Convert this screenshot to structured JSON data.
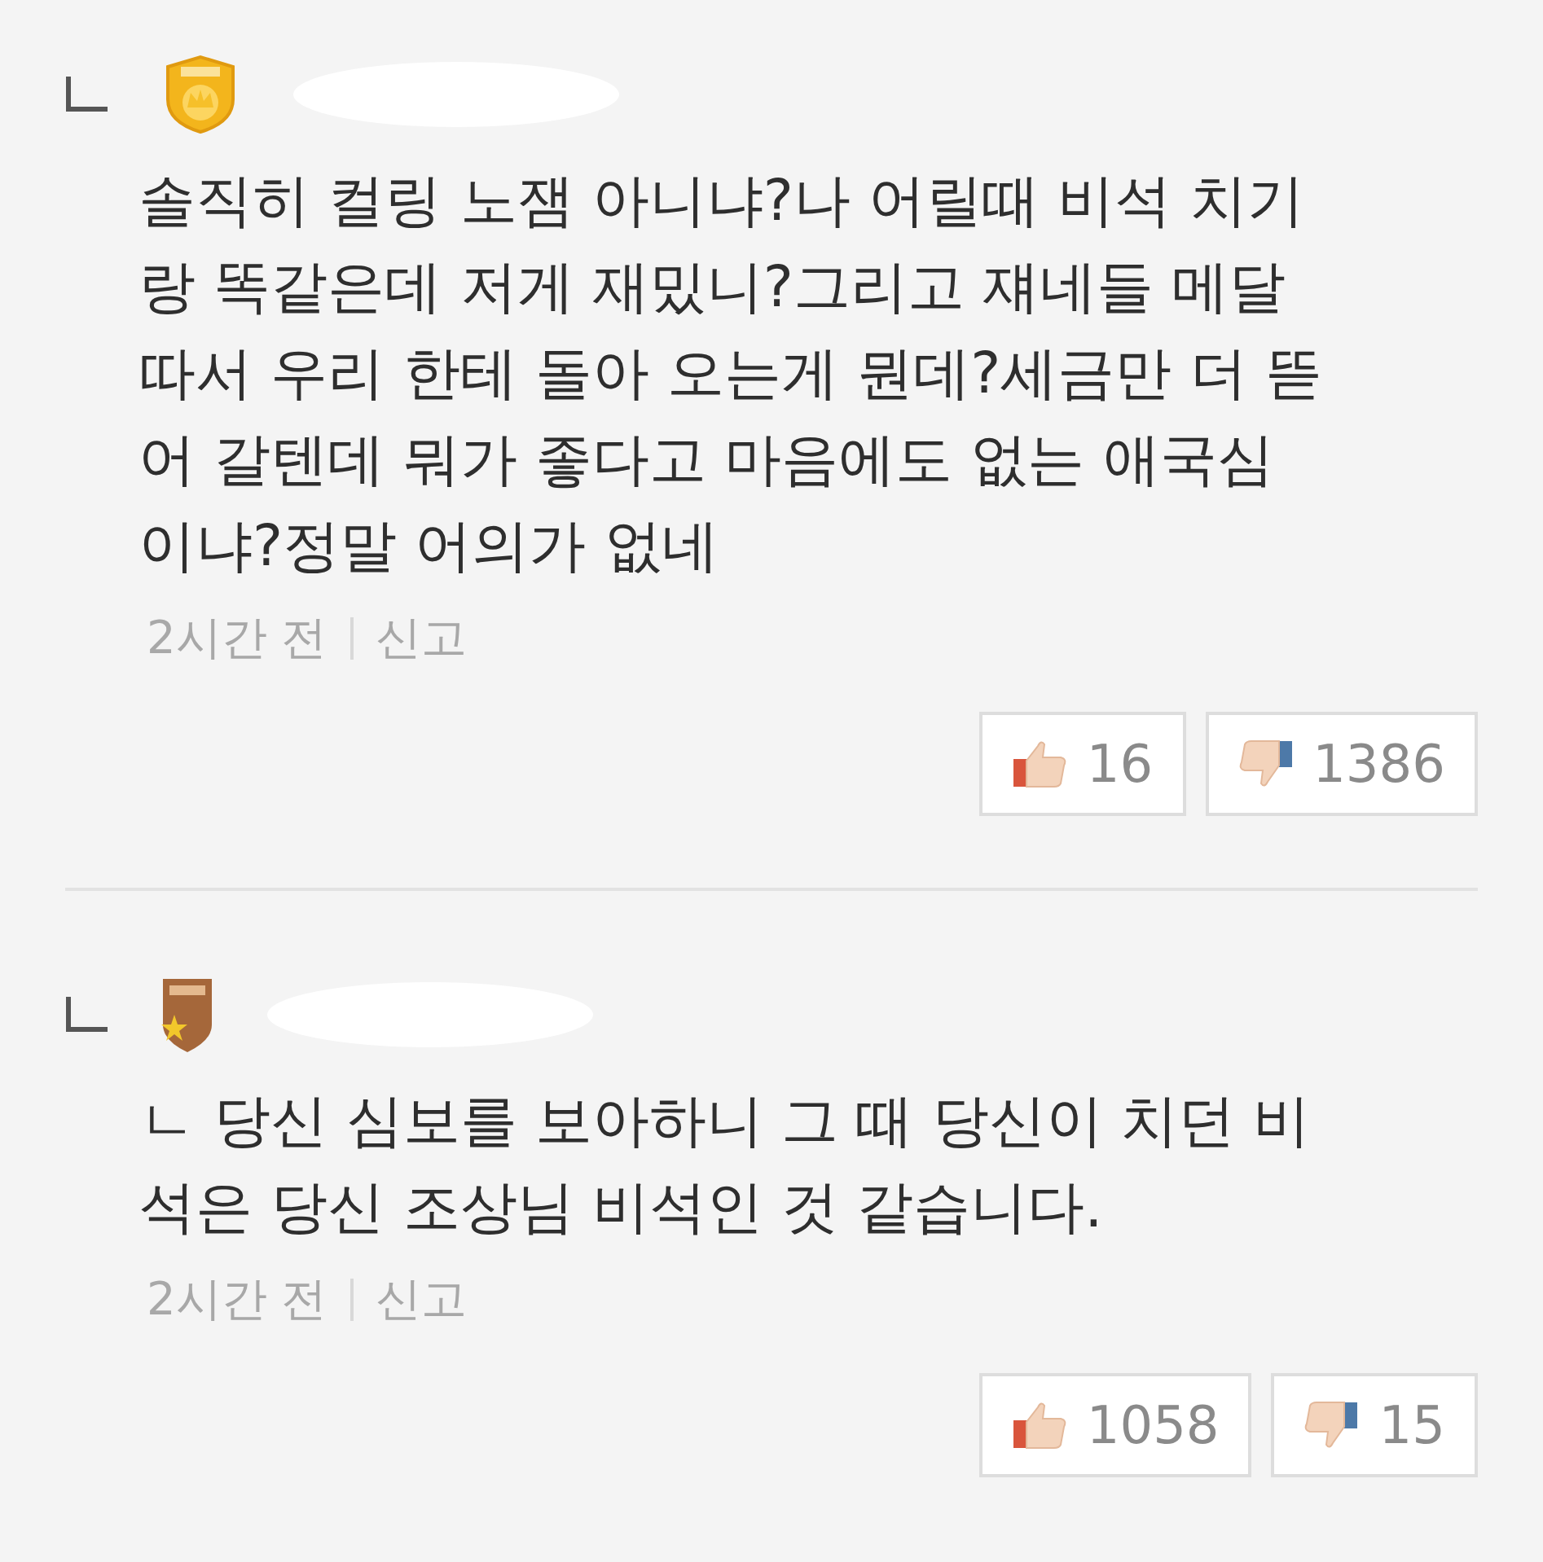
{
  "comments": [
    {
      "kind": "crown",
      "body_lines": [
        "솔직히 컬링 노잼 아니냐?나 어릴때 비석 치기",
        "랑 똑같은데 저게 재밌니?그리고 쟤네들 메달",
        "따서 우리 한테 돌아 오는게 뭔데?세금만 더 뜯",
        "어 갈텐데 뭐가 좋다고 마음에도 없는 애국심",
        "이냐?정말 어의가 없네"
      ],
      "time": "2시간 전",
      "report": "신고",
      "likes": "16",
      "dislikes": "1386"
    },
    {
      "kind": "star",
      "body_lines": [
        "ㄴ 당신 심보를 보아하니 그 때 당신이 치던 비",
        "석은 당신 조상님 비석인 것 같습니다."
      ],
      "time": "2시간 전",
      "report": "신고",
      "likes": "1058",
      "dislikes": "15"
    }
  ]
}
